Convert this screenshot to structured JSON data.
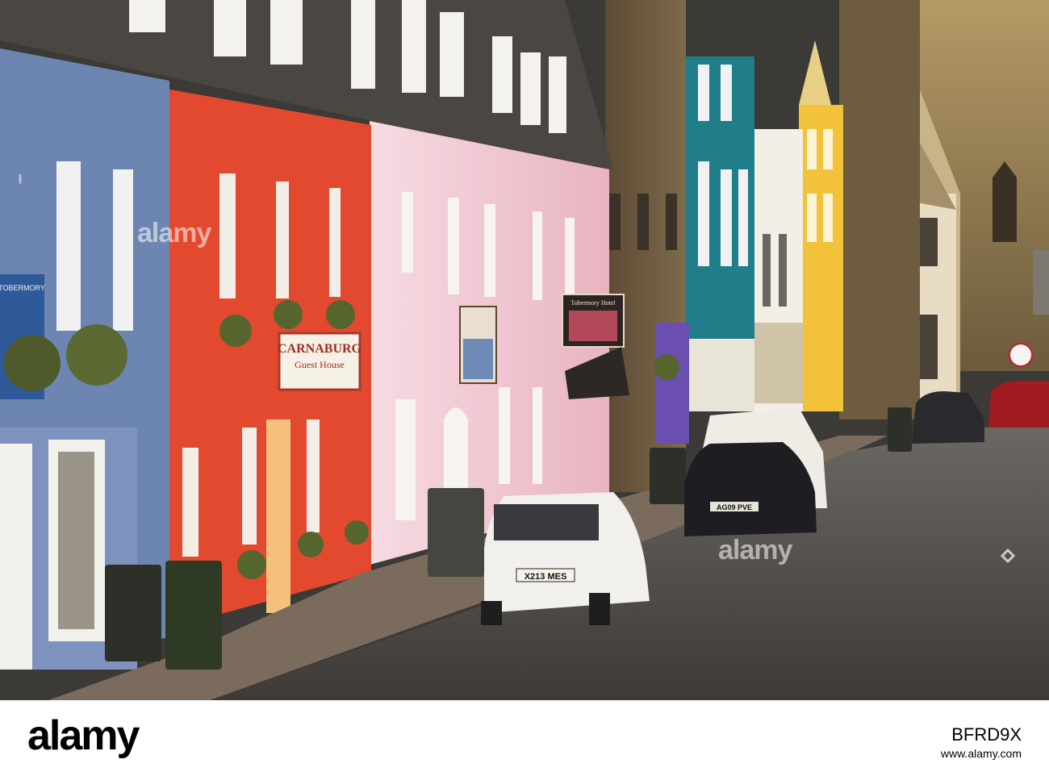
{
  "watermark": {
    "text": "alamy",
    "footer_logo": "alamy",
    "image_id": "BFRD9X",
    "url": "www.alamy.com"
  },
  "signs": {
    "guesthouse_name": "CARNABURG",
    "guesthouse_sub": "Guest House",
    "tobermory_left": "TOBERMORY",
    "hotel": "Tobermory Hotel",
    "plate_white_car": "X213 MES",
    "plate_black_car": "AG09 PVE"
  },
  "colors": {
    "sky": "#3b3a36",
    "blue_house": "#6d85b1",
    "red_house": "#e2492f",
    "pink_house": "#f2cfd8",
    "teal_house": "#1f7e8a",
    "yellow_house": "#f2c23a",
    "stone": "#6a5a3f",
    "road": "#55524e"
  }
}
